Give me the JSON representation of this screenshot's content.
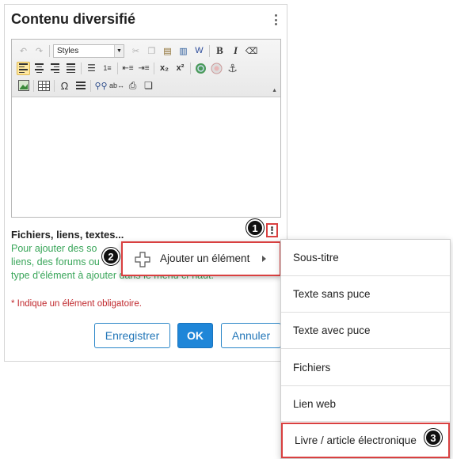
{
  "panel": {
    "title": "Contenu diversifié"
  },
  "editor": {
    "styles_placeholder": "Styles",
    "toolbar_icons": [
      "undo-icon",
      "redo-icon",
      "cut-icon",
      "copy-icon",
      "paste-icon",
      "paste-text-icon",
      "paste-word-icon",
      "bold-icon",
      "italic-icon",
      "eraser-icon",
      "align-left-icon",
      "align-center-icon",
      "align-right-icon",
      "justify-icon",
      "unordered-list-icon",
      "ordered-list-icon",
      "outdent-icon",
      "indent-icon",
      "subscript-icon",
      "superscript-icon",
      "link-icon",
      "unlink-icon",
      "anchor-icon",
      "image-icon",
      "table-icon",
      "special-char-icon",
      "horizontal-rule-icon",
      "find-icon",
      "replace-icon",
      "print-icon",
      "templates-icon"
    ]
  },
  "files": {
    "label": "Fichiers, liens, textes...",
    "help_line1": "Pour ajouter des so",
    "help_line2": "liens, des forums ou",
    "help_line3": "type d'élément à ajouter dans le menu ci-haut.",
    "required_note": "* Indique un élément obligatoire."
  },
  "buttons": {
    "save": "Enregistrer",
    "ok": "OK",
    "cancel": "Annuler"
  },
  "context_menu": {
    "add_element": "Ajouter un élément"
  },
  "submenu": {
    "items": [
      "Sous-titre",
      "Texte sans puce",
      "Texte avec puce",
      "Fichiers",
      "Lien web",
      "Livre / article électronique"
    ]
  },
  "badges": [
    "1",
    "2",
    "3"
  ],
  "colors": {
    "highlight": "#d94040",
    "help_text": "#3aa65a",
    "required": "#c0282d",
    "primary": "#1f86d8"
  }
}
